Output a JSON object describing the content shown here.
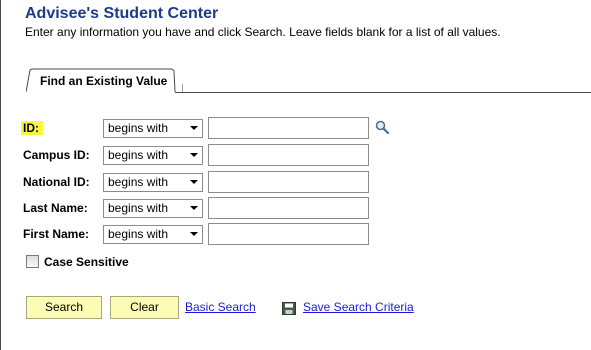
{
  "header": {
    "title": "Advisee's Student Center",
    "instructions": "Enter any information you have and click Search. Leave fields blank for a list of all values."
  },
  "tabs": [
    {
      "label": "Find an Existing Value",
      "active": true
    }
  ],
  "fields": [
    {
      "label": "ID:",
      "operator": "begins with",
      "value": "",
      "highlighted": true,
      "has_lookup": true
    },
    {
      "label": "Campus ID:",
      "operator": "begins with",
      "value": ""
    },
    {
      "label": "National ID:",
      "operator": "begins with",
      "value": ""
    },
    {
      "label": "Last Name:",
      "operator": "begins with",
      "value": ""
    },
    {
      "label": "First Name:",
      "operator": "begins with",
      "value": ""
    }
  ],
  "options": {
    "case_sensitive_label": "Case Sensitive",
    "case_sensitive_checked": false
  },
  "actions": {
    "search_label": "Search",
    "clear_label": "Clear",
    "basic_search_label": "Basic Search",
    "save_search_label": "Save Search Criteria"
  },
  "colors": {
    "title": "#1d3b86",
    "button_bg": "#fdfcb4",
    "link": "#1b1bd6",
    "highlight": "#f7f73f"
  },
  "icons": {
    "lookup": "magnifier-icon",
    "save": "floppy-disk-icon",
    "dropdown": "chevron-down-icon"
  }
}
